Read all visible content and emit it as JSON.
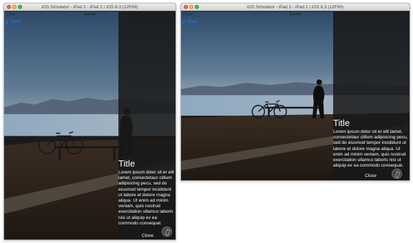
{
  "simulator": {
    "window_title": "iOS Simulator - iPad 2 - iPad 2 / iOS 8.3 (12F69)"
  },
  "status_bar": {
    "carrier": "Carrier",
    "time": "4:56 PM"
  },
  "nav": {
    "back_label": "Back"
  },
  "detail_panel": {
    "title": "Title",
    "body": "Lorem ipsum dolor sit er elit lamet, consectetaur cillium adipisicing pecu, sed do eiusmod tempor incididunt ut labore et dolore magna aliqua. Ut enim ad minim veniam, quis nostrud exercitation ullamco laboris nisi ut aliquip ex ea commodo consequat.",
    "close_label": "Close"
  },
  "colors": {
    "ios_blue": "#1a7cf6",
    "panel_overlay": "#181818"
  },
  "icons": {
    "back": "chevron-left-icon",
    "home": "home-button-icon",
    "battery": "battery-icon"
  }
}
